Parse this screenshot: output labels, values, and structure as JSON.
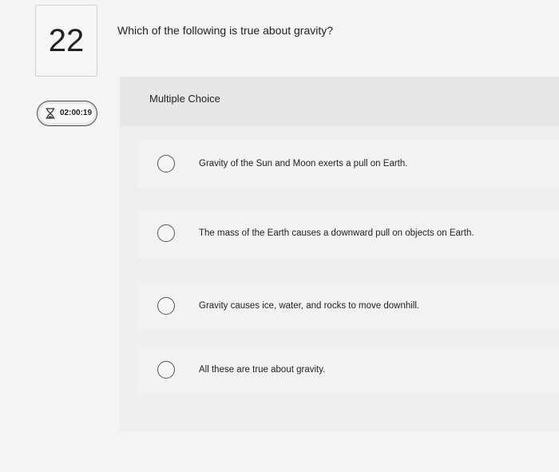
{
  "question": {
    "number": "22",
    "text": "Which of the following is true about gravity?"
  },
  "timer": {
    "icon": "hourglass-icon",
    "time": "02:00:19"
  },
  "answer_panel": {
    "type_label": "Multiple Choice",
    "options": [
      {
        "label": "Gravity of the Sun and Moon exerts a pull on Earth."
      },
      {
        "label": "The mass of the Earth causes a downward pull on objects on Earth."
      },
      {
        "label": "Gravity causes ice, water, and rocks to move downhill."
      },
      {
        "label": "All these are true about gravity."
      }
    ]
  }
}
